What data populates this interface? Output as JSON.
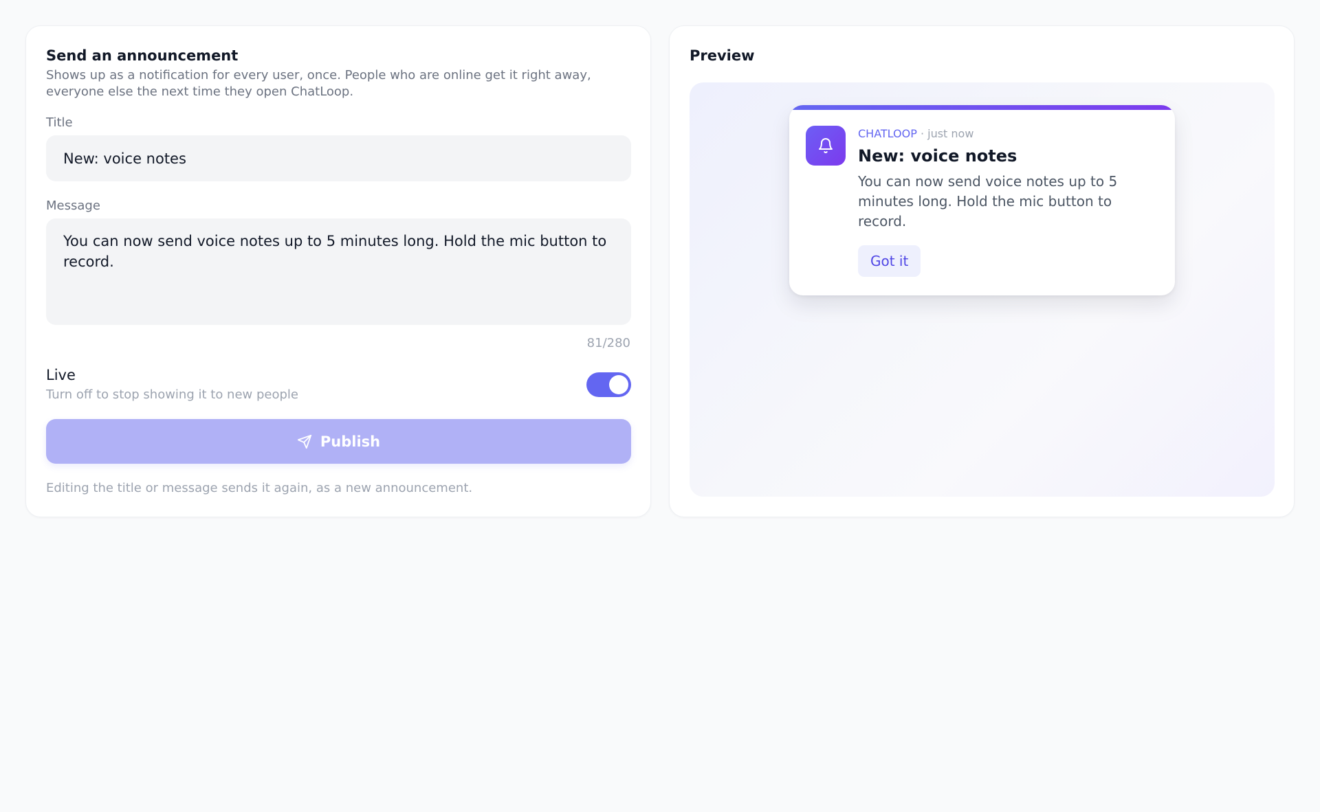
{
  "composer": {
    "heading": "Send an announcement",
    "description": "Shows up as a notification for every user, once. People who are online get it right away, everyone else the next time they open ChatLoop.",
    "title_label": "Title",
    "title_value": "New: voice notes",
    "message_label": "Message",
    "message_value": "You can now send voice notes up to 5 minutes long. Hold the mic button to record.",
    "char_count": "81/280",
    "live_label": "Live",
    "live_sub": "Turn off to stop showing it to new people",
    "live_on": true,
    "publish_label": "Publish",
    "publish_icon": "send-icon",
    "footnote": "Editing the title or message sends it again, as a new announcement."
  },
  "preview": {
    "heading": "Preview",
    "notification": {
      "icon": "bell-icon",
      "app_name": "CHATLOOP",
      "time": " · just now",
      "title": "New: voice notes",
      "body": "You can now send voice notes up to 5 minutes long. Hold the mic button to record.",
      "button_label": "Got it"
    }
  },
  "colors": {
    "accent": "#6366f1",
    "accent_purple": "#7c3aed",
    "publish_disabled": "#b0b1f6",
    "background": "#f9fafb"
  }
}
